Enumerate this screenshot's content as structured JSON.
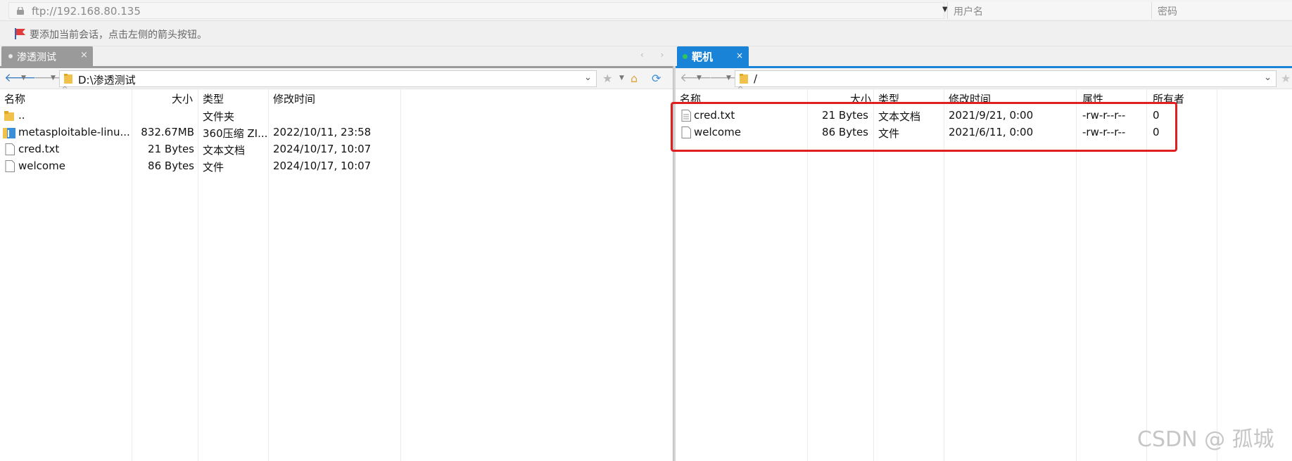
{
  "address_bar": {
    "url": "ftp://192.168.80.135",
    "username_placeholder": "用户名",
    "password_placeholder": "密码"
  },
  "info_bar": {
    "text": "要添加当前会话，点击左侧的箭头按钮。"
  },
  "tabs": {
    "left": {
      "label": "渗透测试",
      "close": "×"
    },
    "right": {
      "label": "靶机",
      "close": "×"
    },
    "nav_arrows": "‹ ›"
  },
  "left_pane": {
    "path": "D:\\渗透测试",
    "columns": {
      "name": "名称",
      "size": "大小",
      "type": "类型",
      "modified": "修改时间"
    },
    "rows": [
      {
        "icon": "folder-up-icon",
        "name": "..",
        "size": "",
        "type": "文件夹",
        "modified": ""
      },
      {
        "icon": "zip-archive-icon",
        "name": "metasploitable-linu...",
        "size": "832.67MB",
        "type": "360压缩 ZI...",
        "modified": "2022/10/11, 23:58"
      },
      {
        "icon": "file-icon",
        "name": "cred.txt",
        "size": "21 Bytes",
        "type": "文本文档",
        "modified": "2024/10/17, 10:07"
      },
      {
        "icon": "file-icon",
        "name": "welcome",
        "size": "86 Bytes",
        "type": "文件",
        "modified": "2024/10/17, 10:07"
      }
    ]
  },
  "right_pane": {
    "path": "/",
    "columns": {
      "name": "名称",
      "size": "大小",
      "type": "类型",
      "modified": "修改时间",
      "perms": "属性",
      "owner": "所有者"
    },
    "rows": [
      {
        "icon": "text-file-icon",
        "name": "cred.txt",
        "size": "21 Bytes",
        "type": "文本文档",
        "modified": "2021/9/21, 0:00",
        "perms": "-rw-r--r--",
        "owner": "0"
      },
      {
        "icon": "file-icon",
        "name": "welcome",
        "size": "86 Bytes",
        "type": "文件",
        "modified": "2021/6/11, 0:00",
        "perms": "-rw-r--r--",
        "owner": "0"
      }
    ]
  },
  "watermark": "CSDN @ 孤城",
  "colors": {
    "accent": "#1883d7",
    "highlight_box": "#e02020",
    "inactive_tab": "#9a9a9a"
  }
}
